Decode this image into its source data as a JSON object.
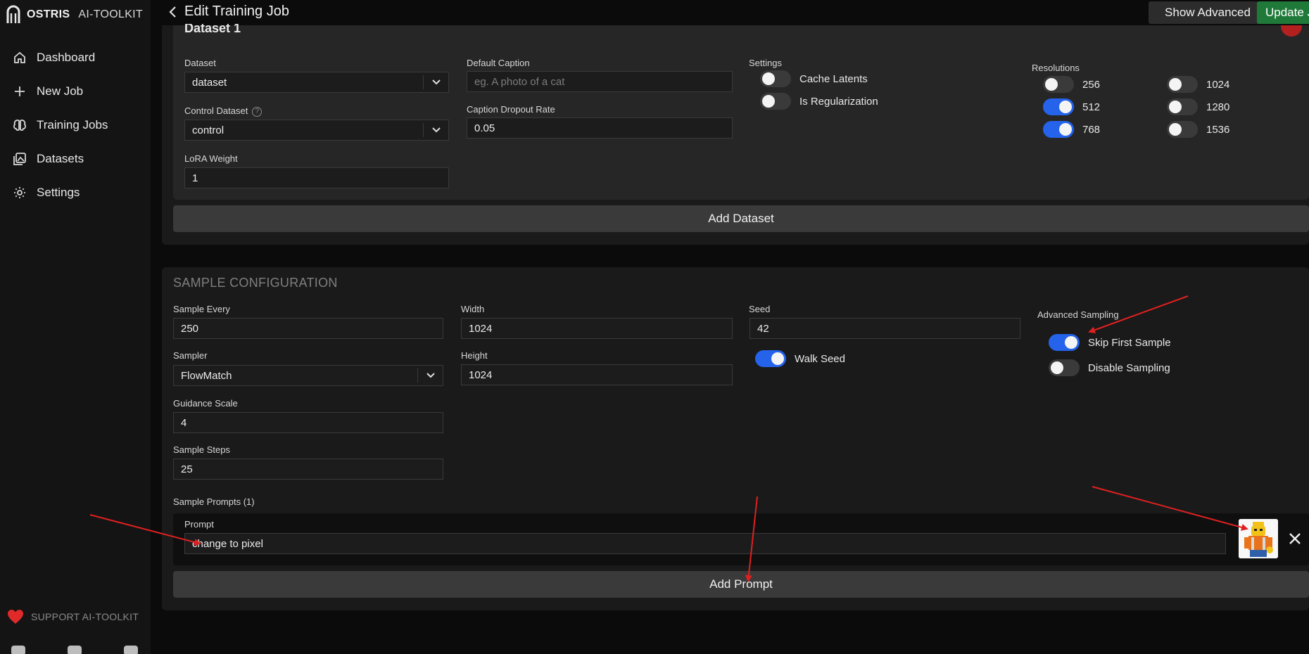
{
  "brand": {
    "name": "OSTRIS",
    "product": "AI-TOOLKIT"
  },
  "header": {
    "title": "Edit Training Job",
    "show_advanced": "Show Advanced",
    "update": "Update Job"
  },
  "sidebar": {
    "items": [
      {
        "label": "Dashboard",
        "icon": "home-icon"
      },
      {
        "label": "New Job",
        "icon": "plus-icon"
      },
      {
        "label": "Training Jobs",
        "icon": "brain-icon"
      },
      {
        "label": "Datasets",
        "icon": "images-icon"
      },
      {
        "label": "Settings",
        "icon": "gear-icon"
      }
    ],
    "support": "SUPPORT AI-TOOLKIT"
  },
  "dataset": {
    "title": "Dataset 1",
    "dataset_label": "Dataset",
    "dataset_value": "dataset",
    "control_label": "Control Dataset",
    "control_value": "control",
    "lora_label": "LoRA Weight",
    "lora_value": "1",
    "caption_label": "Default Caption",
    "caption_placeholder": "eg. A photo of a cat",
    "dropout_label": "Caption Dropout Rate",
    "dropout_value": "0.05",
    "settings_label": "Settings",
    "cache_latents": {
      "label": "Cache Latents",
      "on": false
    },
    "is_regularization": {
      "label": "Is Regularization",
      "on": false
    },
    "resolutions_label": "Resolutions",
    "resolutions": [
      {
        "value": "256",
        "on": false
      },
      {
        "value": "512",
        "on": true
      },
      {
        "value": "768",
        "on": true
      },
      {
        "value": "1024",
        "on": false
      },
      {
        "value": "1280",
        "on": false
      },
      {
        "value": "1536",
        "on": false
      }
    ],
    "add_dataset": "Add Dataset"
  },
  "sample": {
    "title": "SAMPLE CONFIGURATION",
    "sample_every_label": "Sample Every",
    "sample_every": "250",
    "sampler_label": "Sampler",
    "sampler": "FlowMatch",
    "guidance_label": "Guidance Scale",
    "guidance": "4",
    "steps_label": "Sample Steps",
    "steps": "25",
    "width_label": "Width",
    "width": "1024",
    "height_label": "Height",
    "height": "1024",
    "seed_label": "Seed",
    "seed": "42",
    "walk_seed": {
      "label": "Walk Seed",
      "on": true
    },
    "advanced_label": "Advanced Sampling",
    "skip_first": {
      "label": "Skip First Sample",
      "on": true
    },
    "disable_sampling": {
      "label": "Disable Sampling",
      "on": false
    },
    "prompts_label": "Sample Prompts (1)",
    "prompt_label": "Prompt",
    "prompt_value": "change to pixel",
    "add_prompt": "Add Prompt"
  },
  "colors": {
    "accent": "#2563eb",
    "update": "#1f7a3a",
    "annotation": "#e02020"
  }
}
